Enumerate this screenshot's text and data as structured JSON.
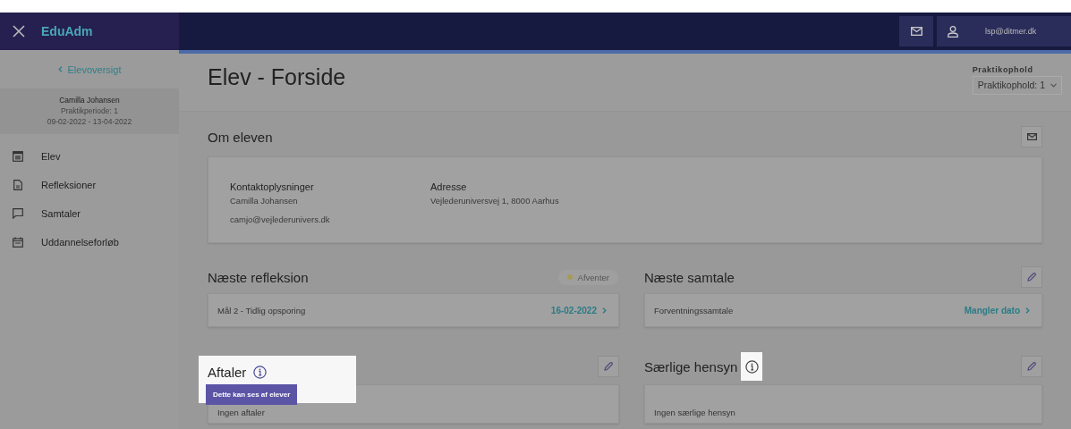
{
  "app": {
    "title": "EduAdm"
  },
  "topbar": {
    "user": "lsp@ditmer.dk"
  },
  "sidebar": {
    "back_link": "Elevoversigt",
    "student": {
      "name": "Camilla Johansen",
      "period": "Praktikperiode: 1",
      "dates": "09-02-2022 - 13-04-2022"
    },
    "items": [
      {
        "label": "Elev"
      },
      {
        "label": "Refleksioner"
      },
      {
        "label": "Samtaler"
      },
      {
        "label": "Uddannelseforløb"
      }
    ]
  },
  "page": {
    "title": "Elev - Forside",
    "selector": {
      "label": "Praktikophold",
      "value": "Praktikophold: 1"
    }
  },
  "about": {
    "title": "Om eleven",
    "contact": {
      "heading": "Kontaktoplysninger",
      "name": "Camilla Johansen",
      "email": "camjo@vejlederunivers.dk"
    },
    "address": {
      "heading": "Adresse",
      "value": "Vejlederuniversvej 1, 8000 Aarhus"
    }
  },
  "next_reflection": {
    "title": "Næste refleksion",
    "status": "Afventer",
    "item": "Mål 2 - Tidlig opsporing",
    "link": "16-02-2022"
  },
  "next_talk": {
    "title": "Næste samtale",
    "item": "Forventningssamtale",
    "link": "Mangler dato"
  },
  "agreements": {
    "title": "Aftaler",
    "highlighted": true,
    "tooltip": "Dette kan ses af elever",
    "empty": "Ingen aftaler"
  },
  "special": {
    "title": "Særlige hensyn",
    "highlighted": true,
    "empty": "Ingen særlige hensyn"
  }
}
